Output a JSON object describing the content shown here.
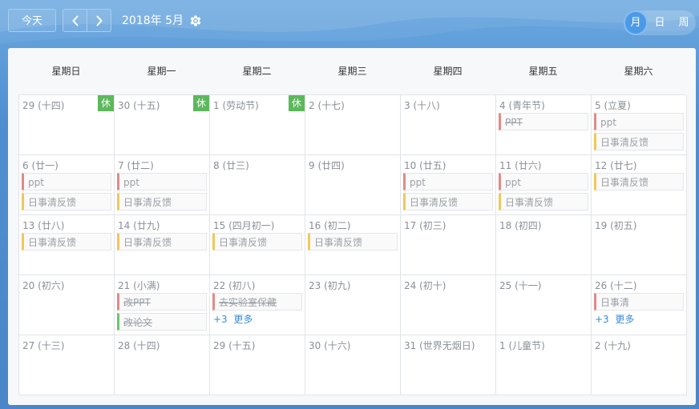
{
  "header": {
    "today_label": "今天",
    "prev_icon": "chevron-left-icon",
    "next_icon": "chevron-right-icon",
    "title": "2018年 5月",
    "settings_icon": "gear-icon",
    "views": [
      {
        "label": "月",
        "active": true
      },
      {
        "label": "日",
        "active": false
      },
      {
        "label": "周",
        "active": false
      }
    ]
  },
  "weekdays": [
    "星期日",
    "星期一",
    "星期二",
    "星期三",
    "星期四",
    "星期五",
    "星期六"
  ],
  "colors": {
    "pink": "#e08a8a",
    "yellow": "#f0c85a",
    "green": "#6cc56c",
    "rest_badge": "#5cb85c",
    "more_link": "#3a8ad6"
  },
  "cells": [
    {
      "date": "29 (十四)",
      "rest": "休",
      "events": []
    },
    {
      "date": "30 (十五)",
      "rest": "休",
      "events": []
    },
    {
      "date": "1 (劳动节)",
      "rest": "休",
      "events": []
    },
    {
      "date": "2 (十七)",
      "events": []
    },
    {
      "date": "3 (十八)",
      "events": []
    },
    {
      "date": "4 (青年节)",
      "events": [
        {
          "text": "PPT",
          "color": "pink",
          "done": true
        }
      ]
    },
    {
      "date": "5 (立夏)",
      "events": [
        {
          "text": "ppt",
          "color": "pink"
        },
        {
          "text": "日事清反馈",
          "color": "yellow"
        }
      ]
    },
    {
      "date": "6 (廿一)",
      "events": [
        {
          "text": "ppt",
          "color": "pink"
        },
        {
          "text": "日事清反馈",
          "color": "yellow"
        }
      ]
    },
    {
      "date": "7 (廿二)",
      "events": [
        {
          "text": "ppt",
          "color": "pink"
        },
        {
          "text": "日事清反馈",
          "color": "yellow"
        }
      ]
    },
    {
      "date": "8 (廿三)",
      "events": []
    },
    {
      "date": "9 (廿四)",
      "events": []
    },
    {
      "date": "10 (廿五)",
      "events": [
        {
          "text": "ppt",
          "color": "pink"
        },
        {
          "text": "日事清反馈",
          "color": "yellow"
        }
      ]
    },
    {
      "date": "11 (廿六)",
      "events": [
        {
          "text": "ppt",
          "color": "pink"
        },
        {
          "text": "日事清反馈",
          "color": "yellow"
        }
      ]
    },
    {
      "date": "12 (廿七)",
      "events": [
        {
          "text": "日事清反馈",
          "color": "yellow"
        }
      ]
    },
    {
      "date": "13 (廿八)",
      "events": [
        {
          "text": "日事清反馈",
          "color": "yellow"
        }
      ]
    },
    {
      "date": "14 (廿九)",
      "events": [
        {
          "text": "日事清反馈",
          "color": "yellow"
        }
      ]
    },
    {
      "date": "15 (四月初一)",
      "events": [
        {
          "text": "日事清反馈",
          "color": "yellow"
        }
      ]
    },
    {
      "date": "16 (初二)",
      "events": [
        {
          "text": "日事清反馈",
          "color": "yellow"
        }
      ]
    },
    {
      "date": "17 (初三)",
      "events": []
    },
    {
      "date": "18 (初四)",
      "events": []
    },
    {
      "date": "19 (初五)",
      "events": []
    },
    {
      "date": "20 (初六)",
      "events": []
    },
    {
      "date": "21 (小满)",
      "events": [
        {
          "text": "改PPT",
          "color": "pink",
          "done": true
        },
        {
          "text": "改论文",
          "color": "green",
          "done": true
        }
      ]
    },
    {
      "date": "22 (初八)",
      "events": [
        {
          "text": "去实验室保藏",
          "color": "pink",
          "done": true
        }
      ],
      "more": {
        "count": "+3",
        "label": "更多"
      }
    },
    {
      "date": "23 (初九)",
      "events": []
    },
    {
      "date": "24 (初十)",
      "events": []
    },
    {
      "date": "25 (十一)",
      "events": []
    },
    {
      "date": "26 (十二)",
      "events": [
        {
          "text": "日事清",
          "color": "pink"
        }
      ],
      "more": {
        "count": "+3",
        "label": "更多"
      }
    },
    {
      "date": "27 (十三)",
      "events": []
    },
    {
      "date": "28 (十四)",
      "events": []
    },
    {
      "date": "29 (十五)",
      "events": []
    },
    {
      "date": "30 (十六)",
      "events": []
    },
    {
      "date": "31 (世界无烟日)",
      "events": []
    },
    {
      "date": "1 (儿童节)",
      "events": []
    },
    {
      "date": "2 (十九)",
      "events": []
    }
  ]
}
